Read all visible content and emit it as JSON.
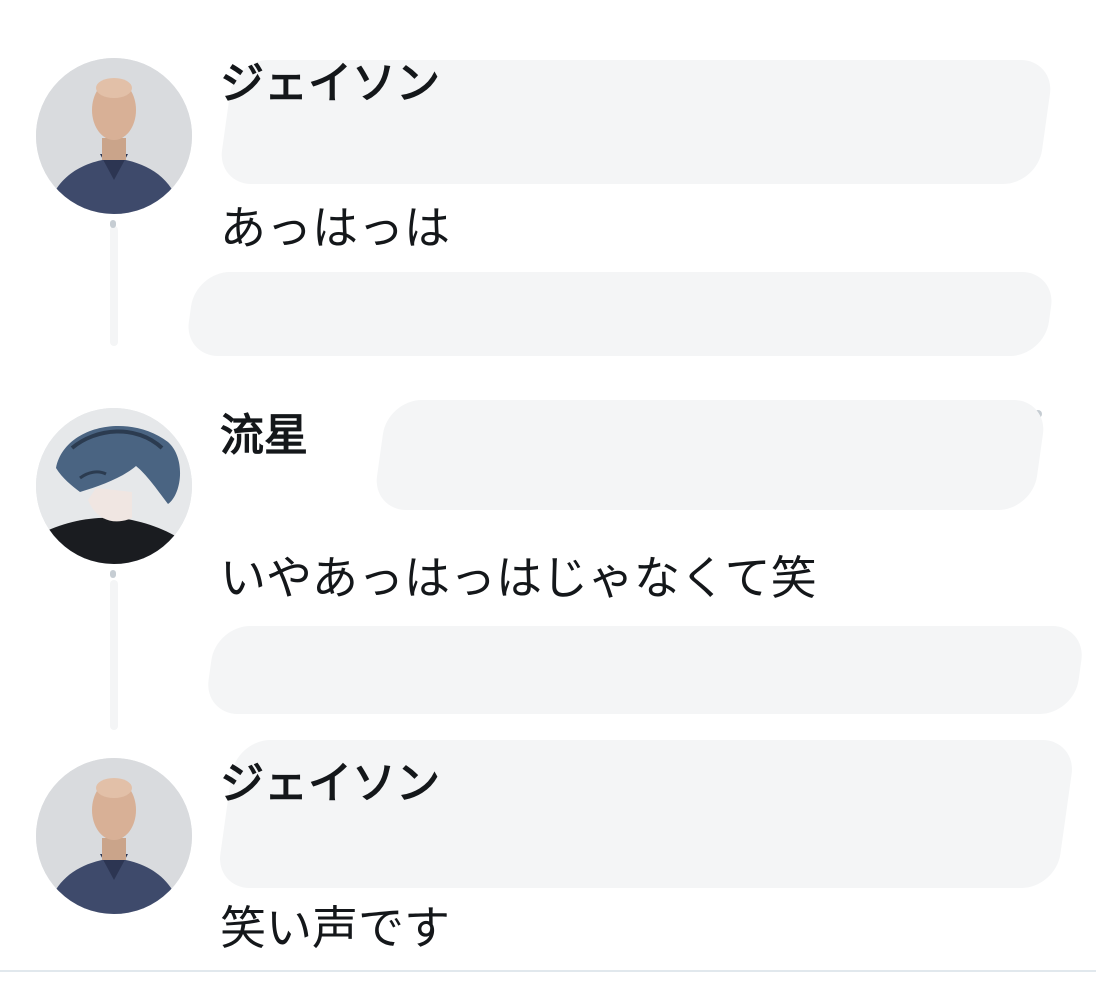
{
  "thread": {
    "tweets": [
      {
        "author": "ジェイソン",
        "avatar_icon": "bald-man-avatar-icon",
        "text": "あっはっは"
      },
      {
        "author": "流星",
        "avatar_icon": "anime-boy-avatar-icon",
        "text": "いやあっはっはじゃなくて笑"
      },
      {
        "author": "ジェイソン",
        "avatar_icon": "bald-man-avatar-icon",
        "text": "笑い声です"
      }
    ]
  },
  "colors": {
    "text": "#14171a",
    "redaction": "#f4f5f6",
    "divider": "#e1e8ed",
    "thread_line": "#c6cdd3"
  }
}
